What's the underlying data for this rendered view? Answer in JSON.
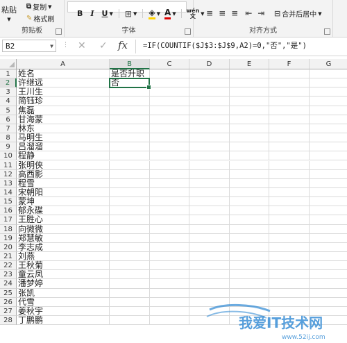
{
  "ribbon": {
    "clipboard": {
      "paste": "粘贴",
      "copy": "复制",
      "format_painter": "格式刷",
      "label": "剪贴板"
    },
    "font": {
      "label": "字体"
    },
    "alignment": {
      "label": "对齐方式",
      "merge": "合并后居中",
      "wrap_icon": "wén"
    }
  },
  "formula_bar": {
    "name_box": "B2",
    "formula": "=IF(COUNTIF($J$3:$J$9,A2)=0,\"否\",\"是\")"
  },
  "sheet": {
    "columns": [
      "A",
      "B",
      "C",
      "D",
      "E",
      "F",
      "G"
    ],
    "active_col": "B",
    "active_row": 2,
    "rows": [
      {
        "n": "1",
        "a": "姓名",
        "b": "是否升职"
      },
      {
        "n": "2",
        "a": "许继远",
        "b": "否"
      },
      {
        "n": "3",
        "a": "王川生",
        "b": ""
      },
      {
        "n": "4",
        "a": "简钰珍",
        "b": ""
      },
      {
        "n": "5",
        "a": "焦磊",
        "b": ""
      },
      {
        "n": "6",
        "a": "甘海蒙",
        "b": ""
      },
      {
        "n": "7",
        "a": "林东",
        "b": ""
      },
      {
        "n": "8",
        "a": "马明生",
        "b": ""
      },
      {
        "n": "9",
        "a": "吕溜溜",
        "b": ""
      },
      {
        "n": "10",
        "a": "程静",
        "b": ""
      },
      {
        "n": "11",
        "a": "张明侠",
        "b": ""
      },
      {
        "n": "12",
        "a": "高西影",
        "b": ""
      },
      {
        "n": "13",
        "a": "程雪",
        "b": ""
      },
      {
        "n": "14",
        "a": "宋朝阳",
        "b": ""
      },
      {
        "n": "15",
        "a": "蒙坤",
        "b": ""
      },
      {
        "n": "16",
        "a": "郁永碟",
        "b": ""
      },
      {
        "n": "17",
        "a": "王胜心",
        "b": ""
      },
      {
        "n": "18",
        "a": "向微微",
        "b": ""
      },
      {
        "n": "19",
        "a": "郑慧敏",
        "b": ""
      },
      {
        "n": "20",
        "a": "李志成",
        "b": ""
      },
      {
        "n": "21",
        "a": "刘燕",
        "b": ""
      },
      {
        "n": "22",
        "a": "王秋菊",
        "b": ""
      },
      {
        "n": "23",
        "a": "童云凤",
        "b": ""
      },
      {
        "n": "24",
        "a": "潘梦婷",
        "b": ""
      },
      {
        "n": "25",
        "a": "张凯",
        "b": ""
      },
      {
        "n": "26",
        "a": "代雪",
        "b": ""
      },
      {
        "n": "27",
        "a": "姜秋宇",
        "b": ""
      },
      {
        "n": "28",
        "a": "丁鹏鹏",
        "b": ""
      }
    ]
  },
  "watermark": {
    "text": "我爱IT技术网",
    "url": "www.52ij.com"
  },
  "colors": {
    "accent": "#217346",
    "watermark": "#3a8fd6"
  }
}
